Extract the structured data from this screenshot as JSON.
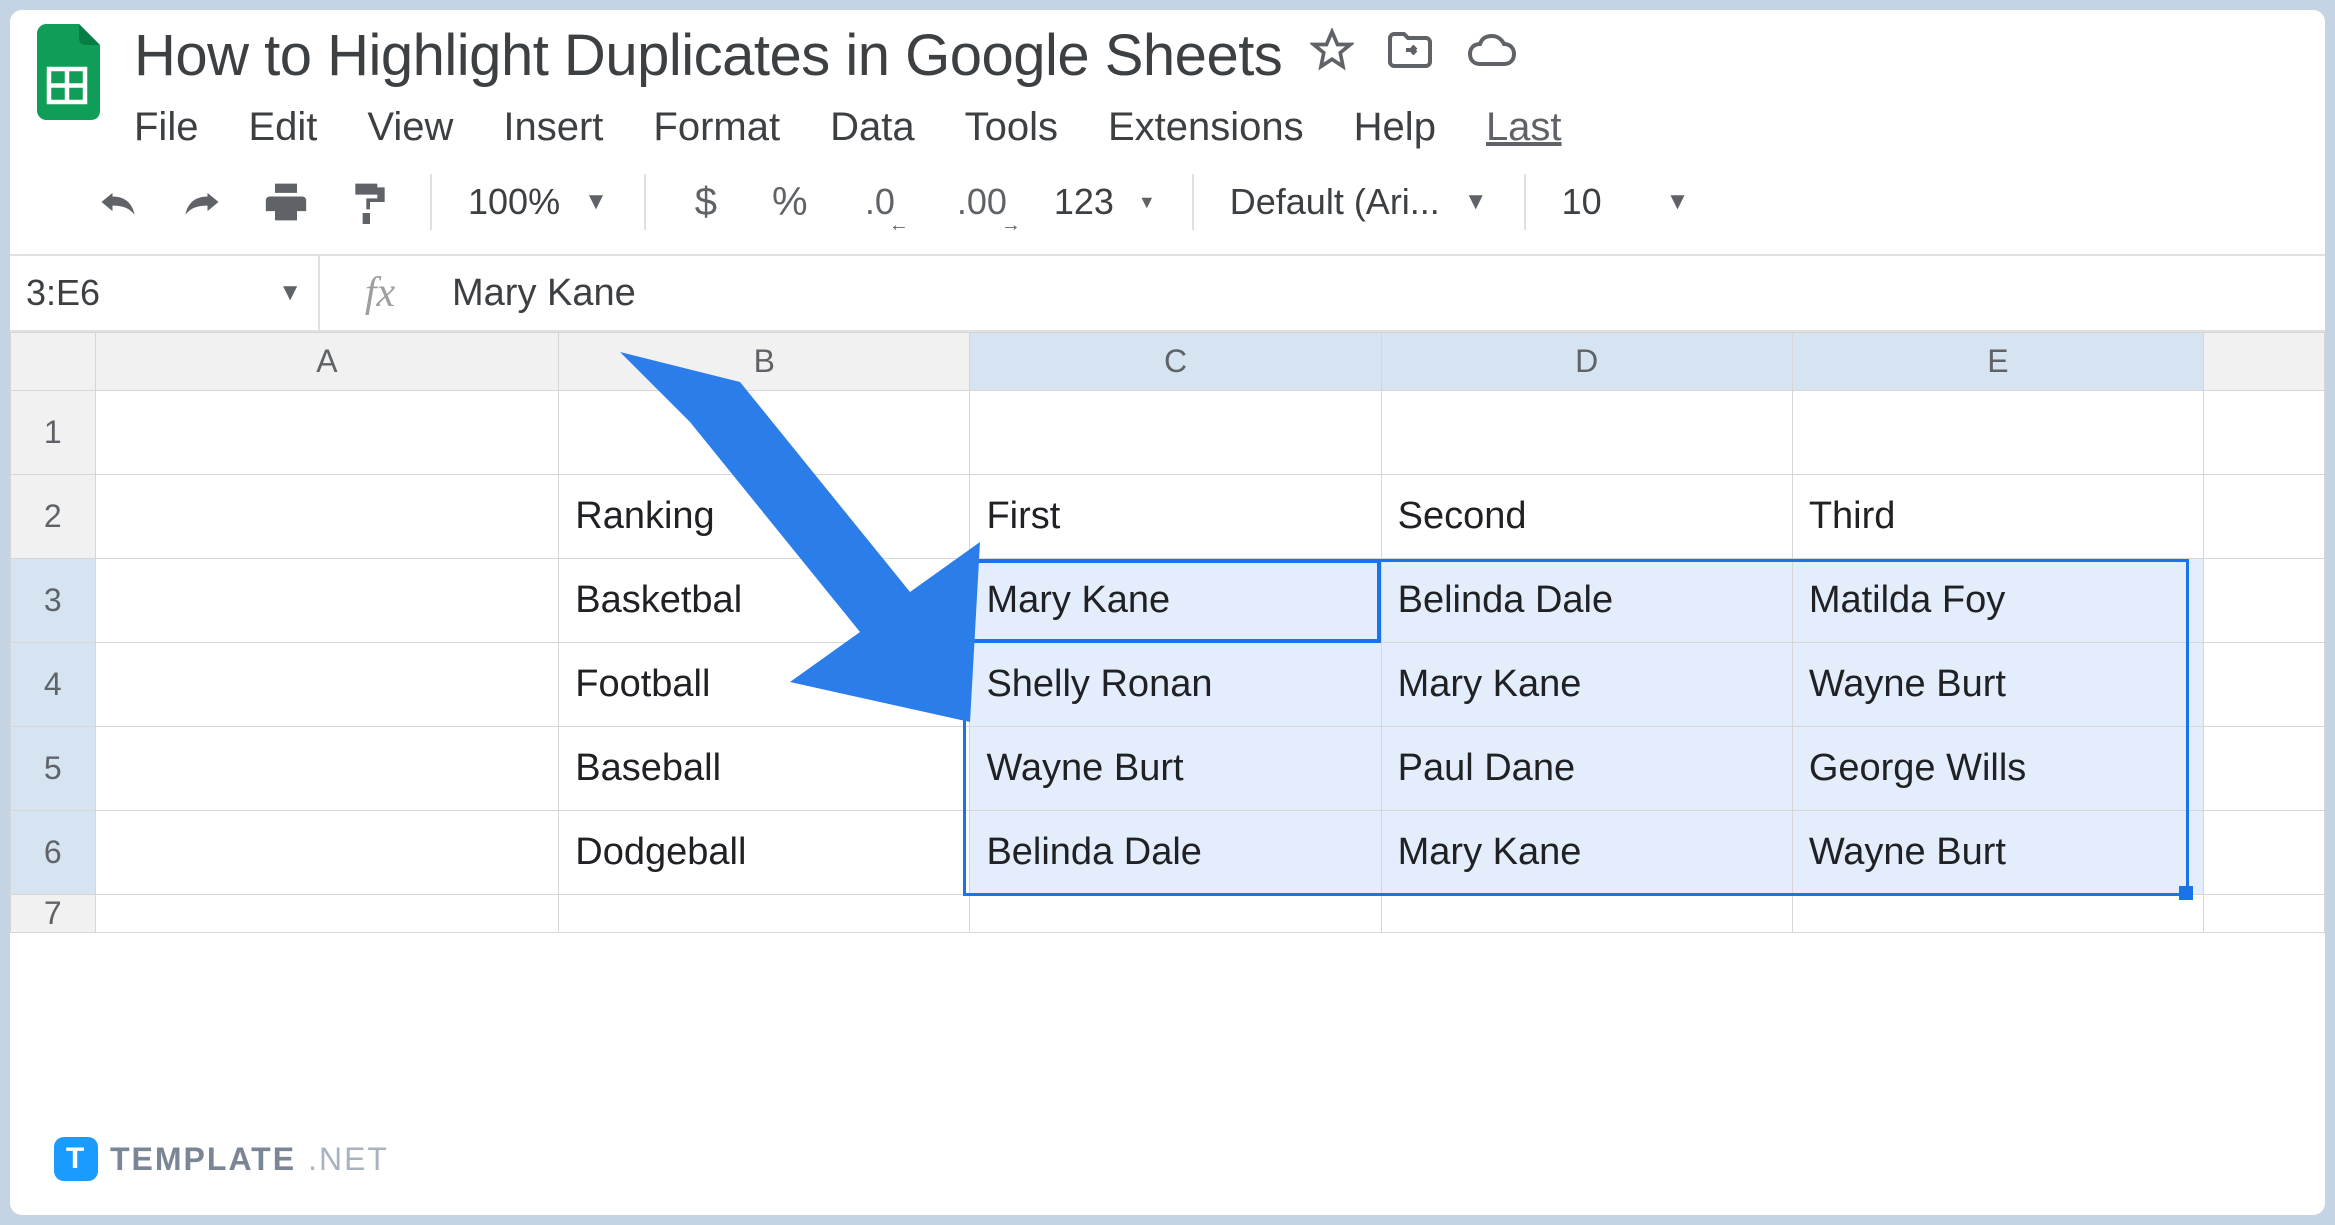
{
  "header": {
    "title": "How to Highlight Duplicates in Google Sheets"
  },
  "menu": {
    "file": "File",
    "edit": "Edit",
    "view": "View",
    "insert": "Insert",
    "format": "Format",
    "data": "Data",
    "tools": "Tools",
    "extensions": "Extensions",
    "help": "Help",
    "last": "Last"
  },
  "toolbar": {
    "zoom": "100%",
    "currency": "$",
    "percent": "%",
    "dec_dec": ".0",
    "inc_dec": ".00",
    "num_fmt": "123",
    "font": "Default (Ari...",
    "font_size": "10"
  },
  "formula": {
    "range": "3:E6",
    "fx": "fx",
    "value": "Mary Kane"
  },
  "cols": [
    "A",
    "B",
    "C",
    "D",
    "E"
  ],
  "rows": [
    "1",
    "2",
    "3",
    "4",
    "5",
    "6",
    "7"
  ],
  "cells": {
    "B2": "Ranking",
    "C2": "First",
    "D2": "Second",
    "E2": "Third",
    "B3": "Basketbal",
    "C3": "Mary Kane",
    "D3": "Belinda Dale",
    "E3": "Matilda Foy",
    "B4": "Football",
    "C4": "Shelly Ronan",
    "D4": "Mary Kane",
    "E4": "Wayne Burt",
    "B5": "Baseball",
    "C5": "Wayne Burt",
    "D5": "Paul Dane",
    "E5": "George Wills",
    "B6": "Dodgeball",
    "C6": "Belinda Dale",
    "D6": "Mary Kane",
    "E6": "Wayne Burt"
  },
  "watermark": {
    "logo": "T",
    "text": "TEMPLATE",
    "suffix": ".NET"
  }
}
